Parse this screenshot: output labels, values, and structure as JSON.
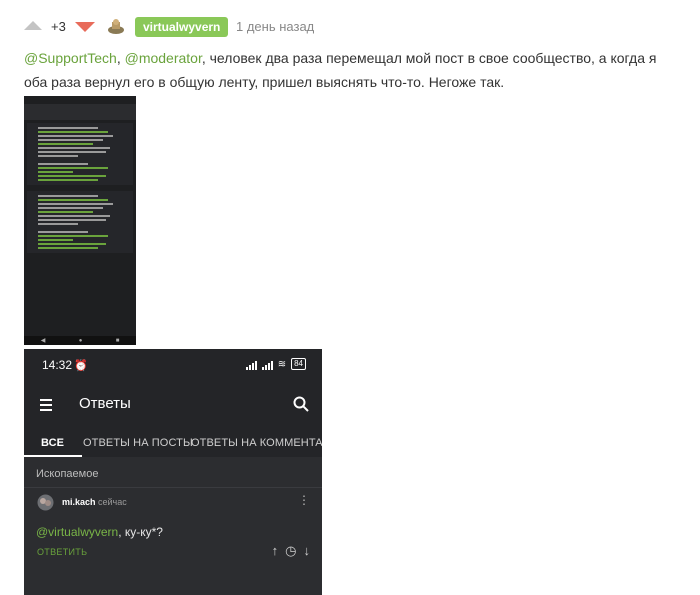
{
  "header": {
    "score": "+3",
    "username": "virtualwyvern",
    "time": "1 день назад"
  },
  "comment": {
    "mention1": "@SupportTech",
    "sep": ", ",
    "mention2": "@moderator",
    "text": ", человек два раза перемещал мой пост в свое сообщество, а когда я оба раза вернул его в общую ленту, пришел выяснять что-то. Негоже так."
  },
  "shot2": {
    "status_time": "14:32",
    "status_battery": "84",
    "app_title": "Ответы",
    "tabs": [
      "ВСЕ",
      "ОТВЕТЫ НА ПОСТЫ",
      "ОТВЕТЫ НА КОММЕНТАР"
    ],
    "group_title": "Ископаемое",
    "comment_user": "mi.kach",
    "comment_time": "сейчас",
    "comment_mention": "@virtualwyvern",
    "comment_text": ", ку-ку*?",
    "reply_label": "ОТВЕТИТЬ"
  },
  "colors": {
    "accent_green": "#8ac858",
    "mention_green": "#6aa33c",
    "downvote_red": "#e86b5a"
  },
  "icons": [
    "upvote-icon",
    "downvote-icon",
    "menu-icon",
    "search-icon",
    "more-icon",
    "arrow-up-icon",
    "clock-icon",
    "arrow-down-icon"
  ]
}
